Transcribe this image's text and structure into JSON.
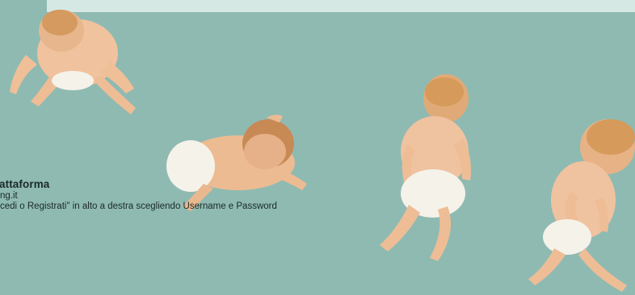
{
  "text_block": {
    "title": "attaforma",
    "line1": "ng.it",
    "line2": "cedi o Registrati\" in alto a destra   scegliendo Username e Password"
  },
  "colors": {
    "background": "#8fbab2",
    "banner": "#d6e8e4",
    "text": "#1a2a27",
    "skin": "#f2c7a3",
    "diaper": "#f5f2ea",
    "hair": "#d69a5b"
  }
}
